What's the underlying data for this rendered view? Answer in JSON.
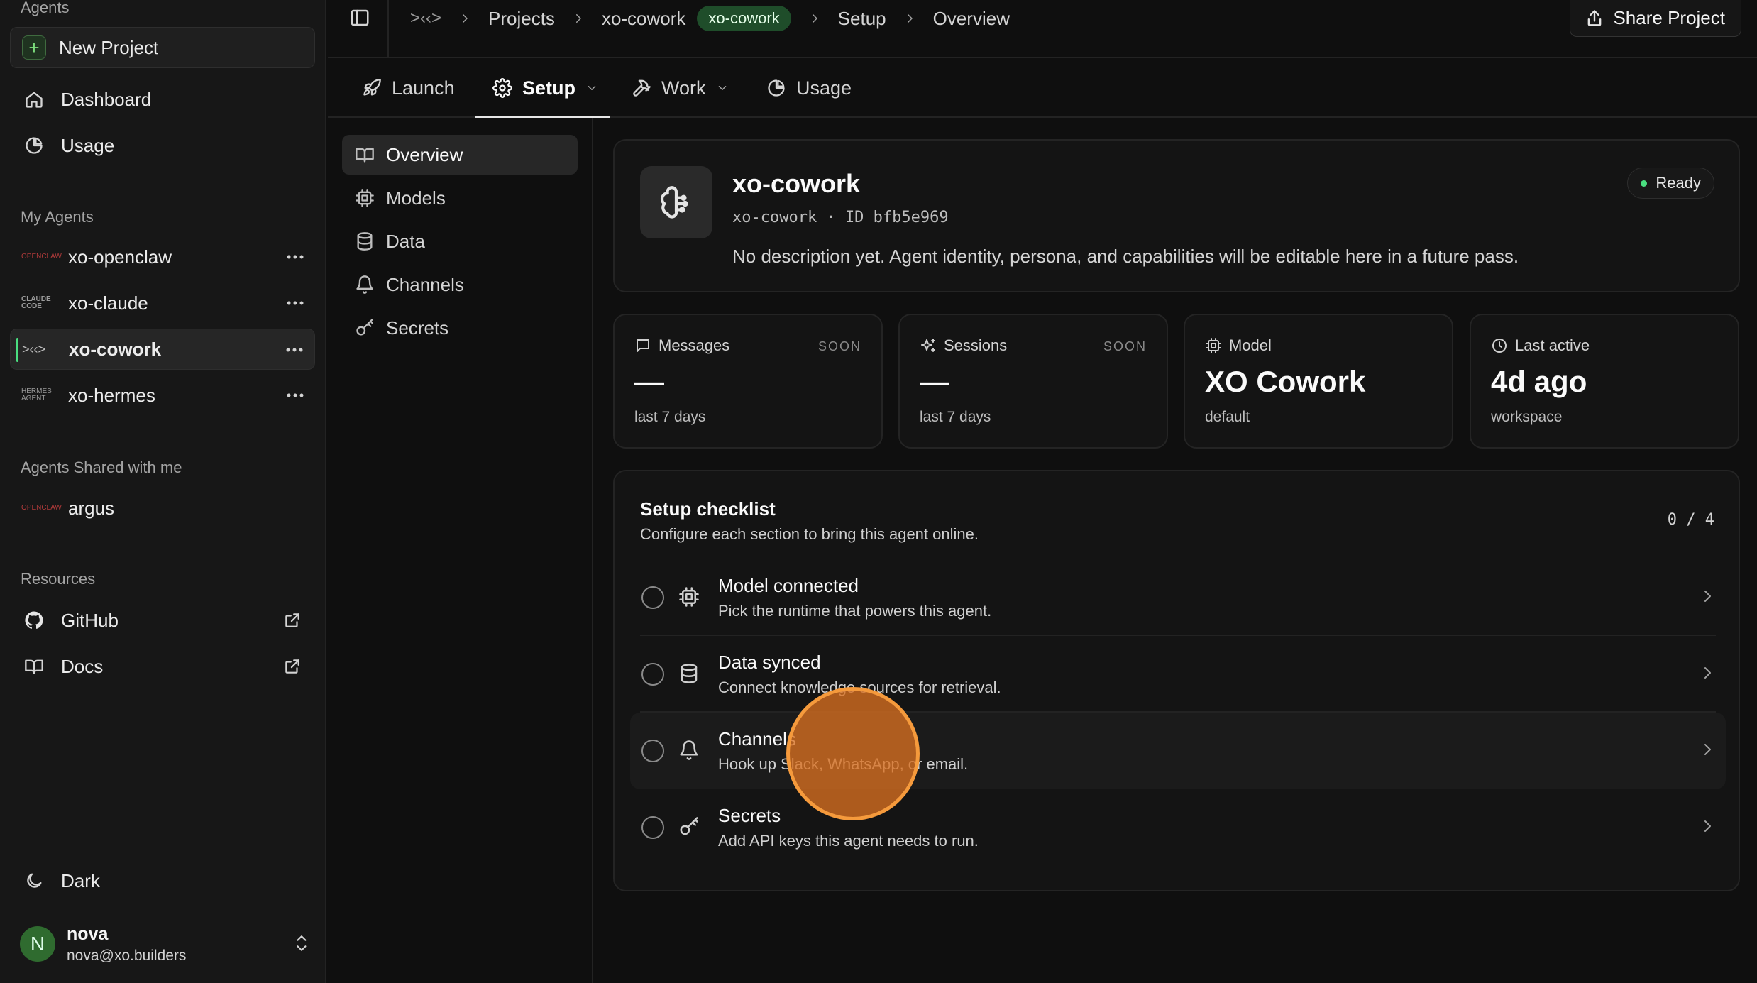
{
  "sidebar": {
    "top_section_label": "Agents",
    "new_project_label": "New Project",
    "nav": [
      {
        "label": "Dashboard",
        "icon": "home-icon"
      },
      {
        "label": "Usage",
        "icon": "pie-chart-icon"
      }
    ],
    "my_agents_label": "My Agents",
    "my_agents": [
      {
        "label": "xo-openclaw",
        "logo": "OPENCLAW",
        "active": false
      },
      {
        "label": "xo-claude",
        "logo": "CLAUDE CODE",
        "active": false
      },
      {
        "label": "xo-cowork",
        "logo": ">‹‹>",
        "active": true
      },
      {
        "label": "xo-hermes",
        "logo": "HERMES AGENT",
        "active": false
      }
    ],
    "shared_label": "Agents Shared with me",
    "shared_agents": [
      {
        "label": "argus",
        "logo": "OPENCLAW"
      }
    ],
    "resources_label": "Resources",
    "resources": [
      {
        "label": "GitHub",
        "icon": "github-icon"
      },
      {
        "label": "Docs",
        "icon": "book-icon"
      }
    ],
    "theme_label": "Dark",
    "user": {
      "initial": "N",
      "name": "nova",
      "email": "nova@xo.builders"
    }
  },
  "topbar": {
    "breadcrumb": {
      "home_logo": ">‹‹>",
      "projects": "Projects",
      "project": "xo-cowork",
      "project_pill": "xo-cowork",
      "section": "Setup",
      "page": "Overview"
    },
    "share_label": "Share Project"
  },
  "tabs": [
    {
      "label": "Launch",
      "icon": "rocket-icon"
    },
    {
      "label": "Setup",
      "icon": "gear-icon"
    },
    {
      "label": "Work",
      "icon": "hammer-icon"
    },
    {
      "label": "Usage",
      "icon": "pie-chart-icon"
    }
  ],
  "subnav": [
    {
      "label": "Overview",
      "icon": "book-icon",
      "active": true
    },
    {
      "label": "Models",
      "icon": "chip-icon"
    },
    {
      "label": "Data",
      "icon": "database-icon"
    },
    {
      "label": "Channels",
      "icon": "bell-icon"
    },
    {
      "label": "Secrets",
      "icon": "key-icon"
    }
  ],
  "agent": {
    "name": "xo-cowork",
    "meta": "xo-cowork · ID bfb5e969",
    "description": "No description yet. Agent identity, persona, and capabilities will be editable here in a future pass.",
    "status": "Ready",
    "status_color": "#4ade80"
  },
  "stats": [
    {
      "label": "Messages",
      "badge": "SOON",
      "value": "—",
      "sub": "last 7 days",
      "icon": "message-icon"
    },
    {
      "label": "Sessions",
      "badge": "SOON",
      "value": "—",
      "sub": "last 7 days",
      "icon": "sparkles-icon"
    },
    {
      "label": "Model",
      "badge": "",
      "value": "XO Cowork",
      "sub": "default",
      "icon": "chip-icon"
    },
    {
      "label": "Last active",
      "badge": "",
      "value": "4d ago",
      "sub": "workspace",
      "icon": "clock-icon"
    }
  ],
  "checklist": {
    "title": "Setup checklist",
    "description": "Configure each section to bring this agent online.",
    "count": "0 / 4",
    "items": [
      {
        "title": "Model connected",
        "description": "Pick the runtime that powers this agent.",
        "icon": "chip-icon"
      },
      {
        "title": "Data synced",
        "description": "Connect knowledge sources for retrieval.",
        "icon": "database-icon"
      },
      {
        "title": "Channels",
        "description": "Hook up Slack, WhatsApp, or email.",
        "icon": "bell-icon"
      },
      {
        "title": "Secrets",
        "description": "Add API keys this agent needs to run.",
        "icon": "key-icon"
      }
    ]
  },
  "colors": {
    "accent_green": "#4ade80",
    "pill_bg": "#1f4d2a",
    "click_indicator": "#f59a3c"
  }
}
